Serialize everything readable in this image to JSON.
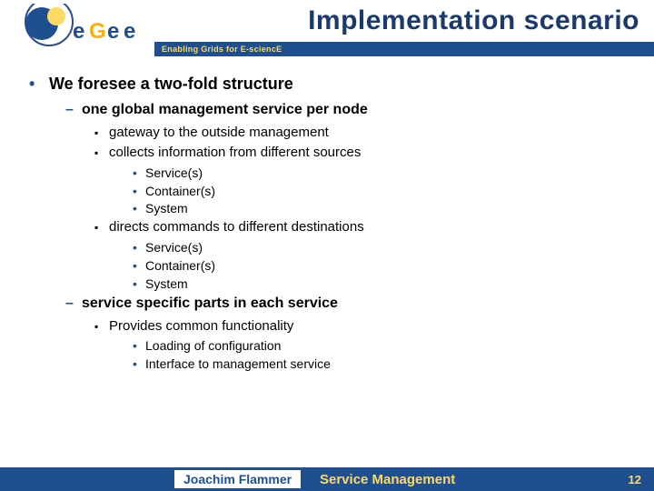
{
  "header": {
    "logo_tagline": "Enabling Grids for E-sciencE",
    "title": "Implementation scenario",
    "logo_text": "egee"
  },
  "content": {
    "l1": "We foresee a two-fold structure",
    "l2a": "one global management service per node",
    "l3a1": "gateway to the outside management",
    "l3a2": "collects information from different sources",
    "l4a2_1": "Service(s)",
    "l4a2_2": "Container(s)",
    "l4a2_3": "System",
    "l3a3": "directs commands to different destinations",
    "l4a3_1": "Service(s)",
    "l4a3_2": "Container(s)",
    "l4a3_3": "System",
    "l2b": "service specific parts in each service",
    "l3b1": "Provides common functionality",
    "l4b1_1": "Loading of configuration",
    "l4b1_2": "Interface to management service"
  },
  "footer": {
    "author": "Joachim Flammer",
    "topic": "Service Management",
    "page": "12"
  }
}
